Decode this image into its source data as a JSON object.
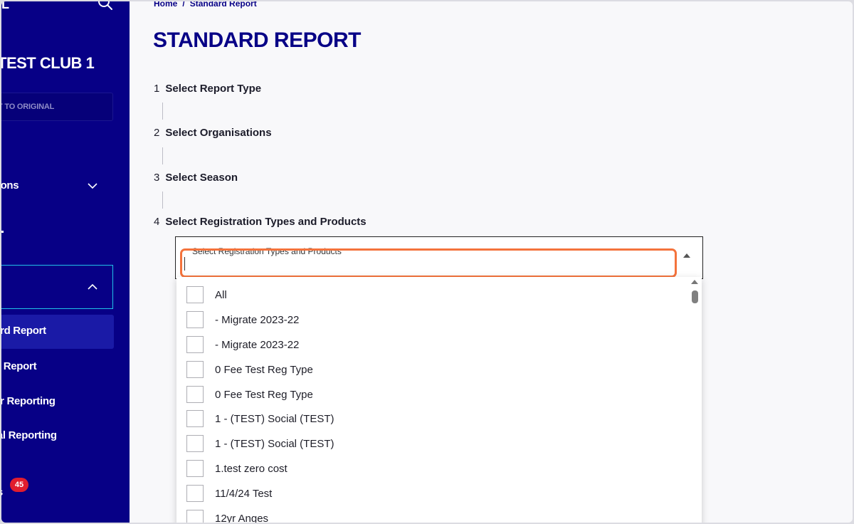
{
  "sidebar": {
    "logo_fragment": "L",
    "club_name": "TEST CLUB 1",
    "revert_label": "T TO ORIGINAL",
    "nav": {
      "organisations": "tions",
      "standard_report": "ard Report",
      "custom_report": "n Report",
      "member_reporting": "er Reporting",
      "financial_reporting": "ial Reporting",
      "approvals": "ls"
    },
    "approvals_badge": "45"
  },
  "breadcrumb": {
    "home": "Home",
    "separator": "/",
    "current": "Standard Report"
  },
  "page_title": "STANDARD REPORT",
  "steps": [
    {
      "num": "1",
      "label": "Select Report Type"
    },
    {
      "num": "2",
      "label": "Select Organisations"
    },
    {
      "num": "3",
      "label": "Select Season"
    },
    {
      "num": "4",
      "label": "Select Registration Types and Products"
    }
  ],
  "select": {
    "label": "Select Registration Types and Products",
    "value": ""
  },
  "options": [
    "All",
    "- Migrate 2023-22",
    "- Migrate 2023-22",
    "0 Fee Test Reg Type",
    "0 Fee Test Reg Type",
    "1 - (TEST) Social (TEST)",
    "1 - (TEST) Social (TEST)",
    "1.test zero cost",
    "11/4/24 Test",
    "12yr Anges"
  ],
  "colors": {
    "brand_navy": "#070086",
    "active_item": "#1a1aa6",
    "section_outline": "#20c2e8",
    "highlight": "#f4733c",
    "badge": "#e11d2e"
  }
}
